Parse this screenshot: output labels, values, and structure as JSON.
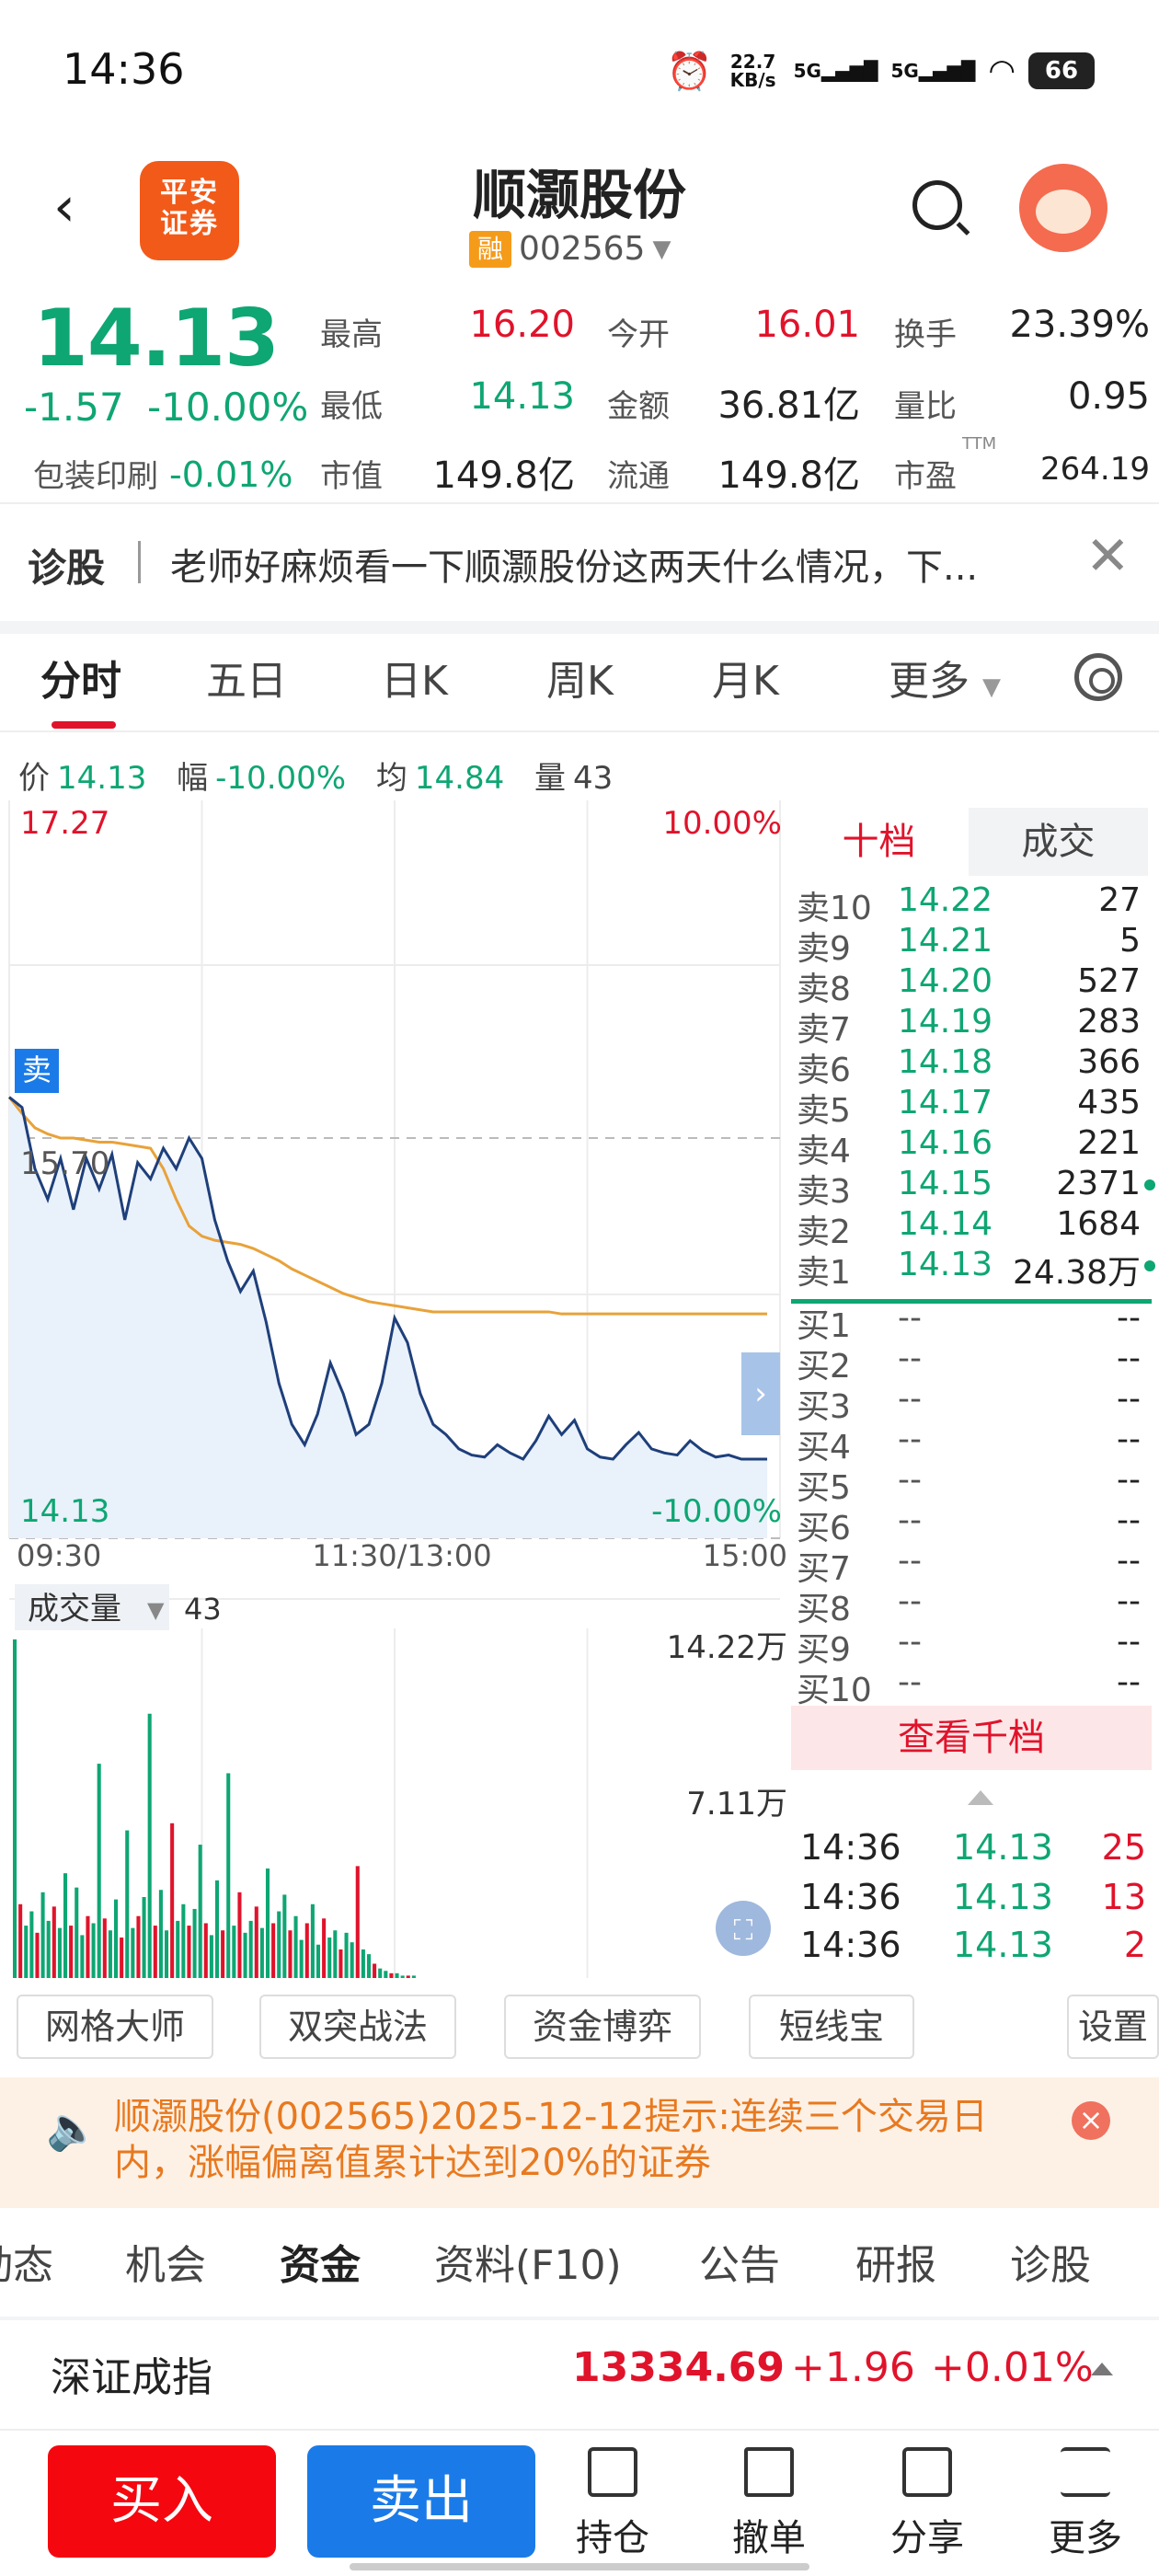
{
  "status_bar": {
    "time": "14:36",
    "net_speed": "22.7 KB/s",
    "sim1": "5G",
    "sim2": "5G",
    "battery": "66"
  },
  "header": {
    "back": "‹",
    "logo_line1": "平安",
    "logo_line2": "证券",
    "stock_name": "顺灏股份",
    "rong_badge": "融",
    "stock_code": "002565"
  },
  "quote": {
    "price": "14.13",
    "change": "-1.57",
    "change_pct": "-10.00%",
    "high_label": "最高",
    "high": "16.20",
    "open_label": "今开",
    "open": "16.01",
    "turnover_label": "换手",
    "turnover": "23.39%",
    "low_label": "最低",
    "low": "14.13",
    "amount_label": "金额",
    "amount": "36.81亿",
    "vol_ratio_label": "量比",
    "vol_ratio": "0.95",
    "sector": "包装印刷",
    "sector_chg": "-0.01%",
    "mktcap_label": "市值",
    "mktcap": "149.8亿",
    "float_label": "流通",
    "float_cap": "149.8亿",
    "pe_label": "市盈",
    "pe_sup": "TTM",
    "pe": "264.19"
  },
  "diagnose": {
    "title": "诊股",
    "message": "老师好麻烦看一下顺灏股份这两天什么情况，下...",
    "close": "✕"
  },
  "chart_tabs": {
    "items": [
      "分时",
      "五日",
      "日K",
      "周K",
      "月K",
      "更多"
    ],
    "active": "分时"
  },
  "chart_info": {
    "price_label": "价",
    "price": "14.13",
    "range_label": "幅",
    "range": "-10.00%",
    "avg_label": "均",
    "avg": "14.84",
    "vol_label": "量",
    "vol": "43"
  },
  "chart_labels": {
    "top_price": "17.27",
    "top_pct": "10.00%",
    "mid_price": "15.70",
    "bot_price": "14.13",
    "bot_pct": "-10.00%",
    "t_start": "09:30",
    "t_mid": "11:30/13:00",
    "t_end": "15:00",
    "sell_marker": "卖",
    "vol_title": "成交量",
    "vol_value": "43",
    "vol_top": "14.22万",
    "vol_mid": "7.11万"
  },
  "chart_data": {
    "type": "line",
    "x_range": [
      "09:30",
      "15:00"
    ],
    "ylim": [
      14.13,
      17.27
    ],
    "series": [
      {
        "name": "价",
        "values": [
          15.9,
          15.85,
          15.55,
          15.4,
          15.6,
          15.35,
          15.6,
          15.45,
          15.62,
          15.3,
          15.58,
          15.5,
          15.65,
          15.55,
          15.7,
          15.6,
          15.3,
          15.1,
          14.95,
          15.05,
          14.8,
          14.5,
          14.3,
          14.2,
          14.35,
          14.6,
          14.45,
          14.25,
          14.3,
          14.5,
          14.82,
          14.7,
          14.45,
          14.3,
          14.25,
          14.18,
          14.15,
          14.14,
          14.2,
          14.16,
          14.13,
          14.22,
          14.34,
          14.25,
          14.32,
          14.18,
          14.14,
          14.13,
          14.2,
          14.26,
          14.18,
          14.16,
          14.15,
          14.22,
          14.17,
          14.14,
          14.15,
          14.13,
          14.13,
          14.13
        ]
      },
      {
        "name": "均",
        "values": [
          15.9,
          15.82,
          15.75,
          15.72,
          15.7,
          15.7,
          15.69,
          15.68,
          15.68,
          15.67,
          15.66,
          15.65,
          15.55,
          15.4,
          15.27,
          15.22,
          15.2,
          15.19,
          15.18,
          15.16,
          15.13,
          15.1,
          15.06,
          15.03,
          15.0,
          14.97,
          14.94,
          14.92,
          14.9,
          14.89,
          14.88,
          14.87,
          14.86,
          14.85,
          14.85,
          14.85,
          14.85,
          14.85,
          14.85,
          14.85,
          14.85,
          14.85,
          14.85,
          14.84,
          14.84,
          14.84,
          14.84,
          14.84,
          14.84,
          14.84,
          14.84,
          14.84,
          14.84,
          14.84,
          14.84,
          14.84,
          14.84,
          14.84,
          14.84,
          14.84
        ]
      }
    ],
    "volume": [
      14.22,
      3.1,
      2.2,
      2.8,
      1.9,
      3.6,
      2.4,
      3.0,
      2.1,
      4.4,
      2.2,
      3.8,
      1.8,
      2.6,
      2.3,
      9.0,
      2.5,
      2.0,
      3.3,
      1.7,
      6.2,
      2.1,
      2.6,
      3.4,
      11.1,
      2.2,
      3.7,
      2.0,
      6.5,
      2.4,
      3.1,
      2.2,
      2.9,
      5.6,
      2.3,
      1.8,
      4.1,
      2.0,
      8.6,
      2.2,
      3.6,
      1.9,
      2.4,
      3.0,
      2.1,
      4.6,
      2.3,
      2.8,
      3.5,
      2.0,
      2.6,
      1.6,
      2.3,
      3.1,
      1.4,
      2.5,
      1.7,
      2.0,
      1.2,
      1.9,
      1.5,
      4.7,
      1.2,
      1.0,
      0.6,
      0.4,
      0.3,
      0.2,
      0.2,
      0.1,
      0.1,
      0.1
    ],
    "vol_ylim": [
      0,
      14.22
    ]
  },
  "order_book": {
    "tab_levels": "十档",
    "tab_trades": "成交",
    "asks": [
      {
        "label": "卖10",
        "price": "14.22",
        "vol": "27"
      },
      {
        "label": "卖9",
        "price": "14.21",
        "vol": "5"
      },
      {
        "label": "卖8",
        "price": "14.20",
        "vol": "527"
      },
      {
        "label": "卖7",
        "price": "14.19",
        "vol": "283"
      },
      {
        "label": "卖6",
        "price": "14.18",
        "vol": "366"
      },
      {
        "label": "卖5",
        "price": "14.17",
        "vol": "435"
      },
      {
        "label": "卖4",
        "price": "14.16",
        "vol": "221"
      },
      {
        "label": "卖3",
        "price": "14.15",
        "vol": "2371"
      },
      {
        "label": "卖2",
        "price": "14.14",
        "vol": "1684"
      },
      {
        "label": "卖1",
        "price": "14.13",
        "vol": "24.38万"
      }
    ],
    "bids": [
      {
        "label": "买1",
        "price": "--",
        "vol": "--"
      },
      {
        "label": "买2",
        "price": "--",
        "vol": "--"
      },
      {
        "label": "买3",
        "price": "--",
        "vol": "--"
      },
      {
        "label": "买4",
        "price": "--",
        "vol": "--"
      },
      {
        "label": "买5",
        "price": "--",
        "vol": "--"
      },
      {
        "label": "买6",
        "price": "--",
        "vol": "--"
      },
      {
        "label": "买7",
        "price": "--",
        "vol": "--"
      },
      {
        "label": "买8",
        "price": "--",
        "vol": "--"
      },
      {
        "label": "买9",
        "price": "--",
        "vol": "--"
      },
      {
        "label": "买10",
        "price": "--",
        "vol": "--"
      }
    ],
    "view_all": "查看千档",
    "ticks": [
      {
        "time": "14:36",
        "price": "14.13",
        "vol": "25"
      },
      {
        "time": "14:36",
        "price": "14.13",
        "vol": "13"
      },
      {
        "time": "14:36",
        "price": "14.13",
        "vol": "2"
      }
    ]
  },
  "tools": [
    "网格大师",
    "双突战法",
    "资金博弈",
    "短线宝",
    "设置"
  ],
  "notice": {
    "text": "顺灏股份(002565)2025-12-12提示:连续三个交易日内，涨幅偏离值累计达到20%的证券",
    "close": "×"
  },
  "bottom_tabs": {
    "items": [
      "动态",
      "机会",
      "资金",
      "资料(F10)",
      "公告",
      "研报",
      "诊股"
    ],
    "active": "资金"
  },
  "index_bar": {
    "name": "深证成指",
    "value": "13334.69",
    "change": "+1.96",
    "pct": "+0.01%"
  },
  "actions": {
    "buy": "买入",
    "sell": "卖出",
    "items": [
      "持仓",
      "撤单",
      "分享",
      "更多"
    ]
  }
}
